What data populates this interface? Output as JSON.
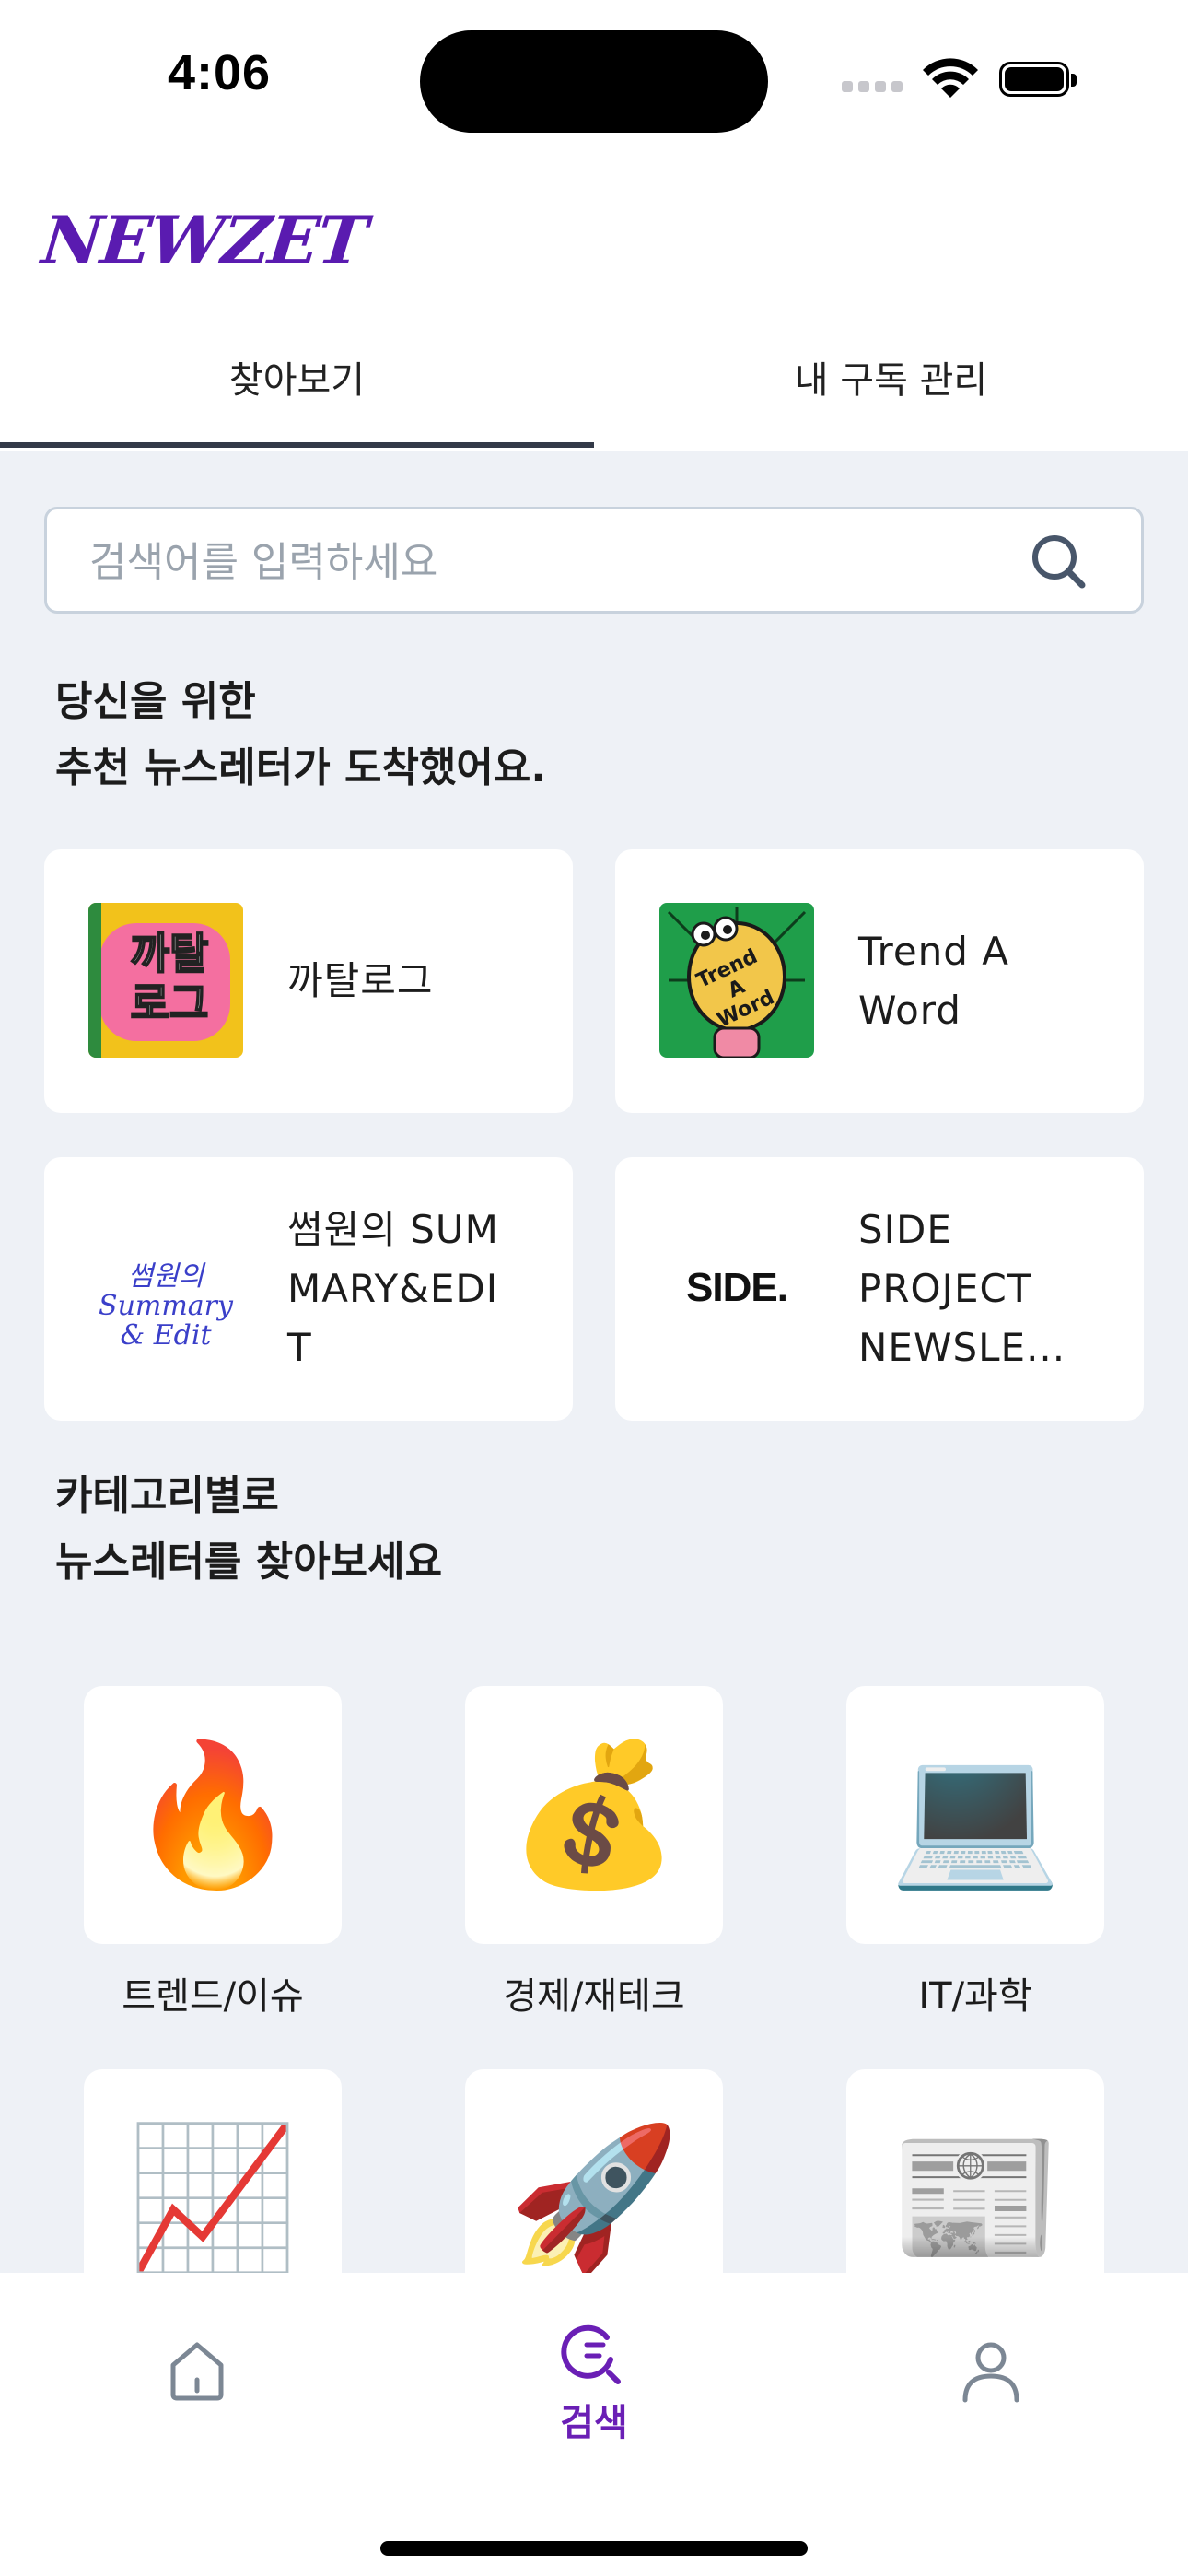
{
  "status_bar": {
    "time": "4:06"
  },
  "app": {
    "logo": "NEWZET"
  },
  "tabs": [
    {
      "label": "찾아보기",
      "active": true
    },
    {
      "label": "내 구독 관리",
      "active": false
    }
  ],
  "search": {
    "placeholder": "검색어를 입력하세요",
    "value": ""
  },
  "recommend": {
    "title_line1": "당신을 위한",
    "title_line2": "추천 뉴스레터가 도착했어요.",
    "cards": [
      {
        "name": "까탈로그",
        "thumb_text": "까탈\n로그"
      },
      {
        "name": "Trend A Word",
        "name_lines": [
          "Trend A",
          "Word"
        ],
        "thumb_text": "Trend A Word"
      },
      {
        "name": "썸원의 SUMMARY&EDIT",
        "name_lines": [
          "썸원의 SUM",
          "MARY&EDI",
          "T"
        ],
        "thumb_text": "Summary & Edit"
      },
      {
        "name": "SIDE PROJECT NEWSLE...",
        "name_lines": [
          "SIDE",
          "PROJECT",
          "NEWSLE..."
        ],
        "thumb_text": "SIDE."
      }
    ]
  },
  "category": {
    "title_line1": "카테고리별로",
    "title_line2": "뉴스레터를 찾아보세요",
    "items": [
      {
        "label": "트렌드/이슈",
        "icon": "fire-emoji"
      },
      {
        "label": "경제/재테크",
        "icon": "money-bag-emoji"
      },
      {
        "label": "IT/과학",
        "icon": "laptop-emoji"
      },
      {
        "label": "",
        "icon": "chart-increasing-emoji"
      },
      {
        "label": "",
        "icon": "rocket-emoji"
      },
      {
        "label": "",
        "icon": "newspaper-emoji"
      }
    ]
  },
  "bottom_nav": {
    "items": [
      {
        "name": "home",
        "label": "",
        "icon": "home-icon"
      },
      {
        "name": "search",
        "label": "검색",
        "icon": "search-nav-icon",
        "active": true
      },
      {
        "name": "profile",
        "label": "",
        "icon": "person-icon"
      }
    ]
  },
  "colors": {
    "brand": "#5a1bb0",
    "background": "#eef1f6",
    "tab_indicator": "#333a48"
  }
}
